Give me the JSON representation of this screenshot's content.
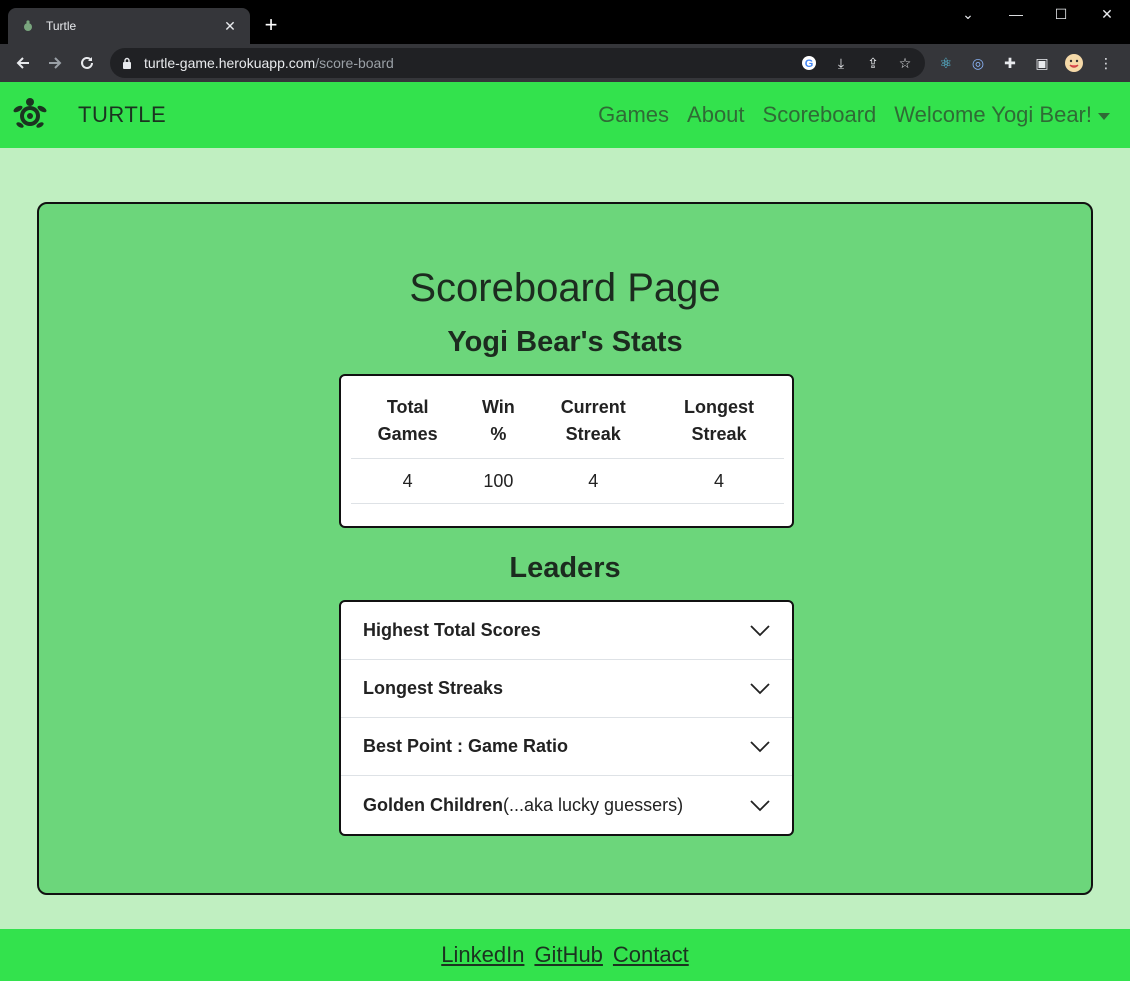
{
  "browser": {
    "tab_title": "Turtle",
    "url_host": "turtle-game.herokuapp.com",
    "url_path": "/score-board"
  },
  "nav": {
    "brand": "TURTLE",
    "links": [
      "Games",
      "About",
      "Scoreboard"
    ],
    "user_menu": "Welcome Yogi Bear!"
  },
  "page": {
    "title": "Scoreboard Page",
    "stats_heading": "Yogi Bear's Stats",
    "stats_table": {
      "headers": [
        [
          "Total",
          "Games"
        ],
        [
          "Win",
          "%"
        ],
        [
          "Current",
          "Streak"
        ],
        [
          "Longest",
          "Streak"
        ]
      ],
      "row": [
        "4",
        "100",
        "4",
        "4"
      ]
    },
    "leaders_heading": "Leaders",
    "leaders": [
      {
        "label": "Highest Total Scores",
        "suffix": ""
      },
      {
        "label": "Longest Streaks",
        "suffix": ""
      },
      {
        "label": "Best Point : Game Ratio",
        "suffix": ""
      },
      {
        "label": "Golden Children",
        "suffix": "(...aka lucky guessers)"
      }
    ]
  },
  "footer": {
    "links": [
      "LinkedIn",
      "GitHub",
      "Contact"
    ]
  },
  "colors": {
    "navbar": "#33e24d",
    "page_bg": "#c0efc1",
    "panel_bg": "#6cd67b"
  }
}
